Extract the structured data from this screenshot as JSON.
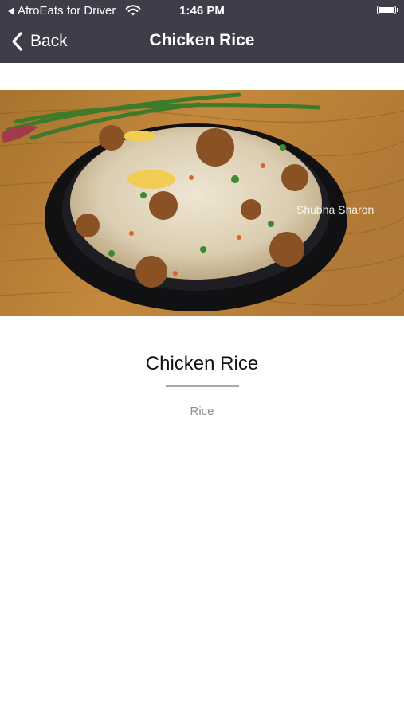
{
  "status_bar": {
    "app_name": "AfroEats for Driver",
    "time": "1:46 PM",
    "icons": [
      "back-arrow-icon",
      "wifi-icon",
      "battery-icon"
    ]
  },
  "nav": {
    "back_label": "Back",
    "title": "Chicken Rice",
    "background_color": "#3d3e4a"
  },
  "item": {
    "name": "Chicken Rice",
    "category": "Rice",
    "image_watermark": "Shubha Sharon"
  }
}
